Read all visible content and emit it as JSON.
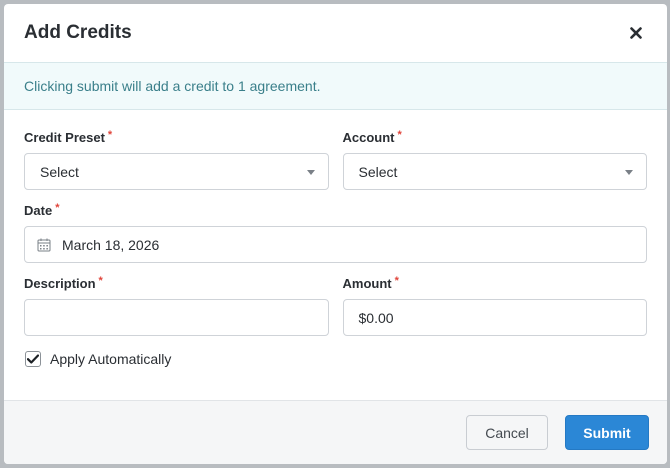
{
  "dialog": {
    "title": "Add Credits"
  },
  "info": {
    "message": "Clicking submit will add a credit to 1 agreement."
  },
  "form": {
    "credit_preset": {
      "label": "Credit Preset",
      "required_mark": "*",
      "value": "Select"
    },
    "account": {
      "label": "Account",
      "required_mark": "*",
      "value": "Select"
    },
    "date": {
      "label": "Date",
      "required_mark": "*",
      "value": "March 18, 2026"
    },
    "description": {
      "label": "Description",
      "required_mark": "*",
      "value": ""
    },
    "amount": {
      "label": "Amount",
      "required_mark": "*",
      "value": "$0.00"
    },
    "apply_automatically": {
      "label": "Apply Automatically",
      "checked": true
    }
  },
  "footer": {
    "cancel_label": "Cancel",
    "submit_label": "Submit"
  },
  "colors": {
    "primary": "#2b87d6",
    "required": "#e0443a",
    "info_text": "#3a7f8a",
    "info_bg": "#f1fafb"
  },
  "icons": {
    "close": "close-icon",
    "calendar": "calendar-icon",
    "dropdown": "chevron-down-icon",
    "check": "checkmark-icon"
  }
}
